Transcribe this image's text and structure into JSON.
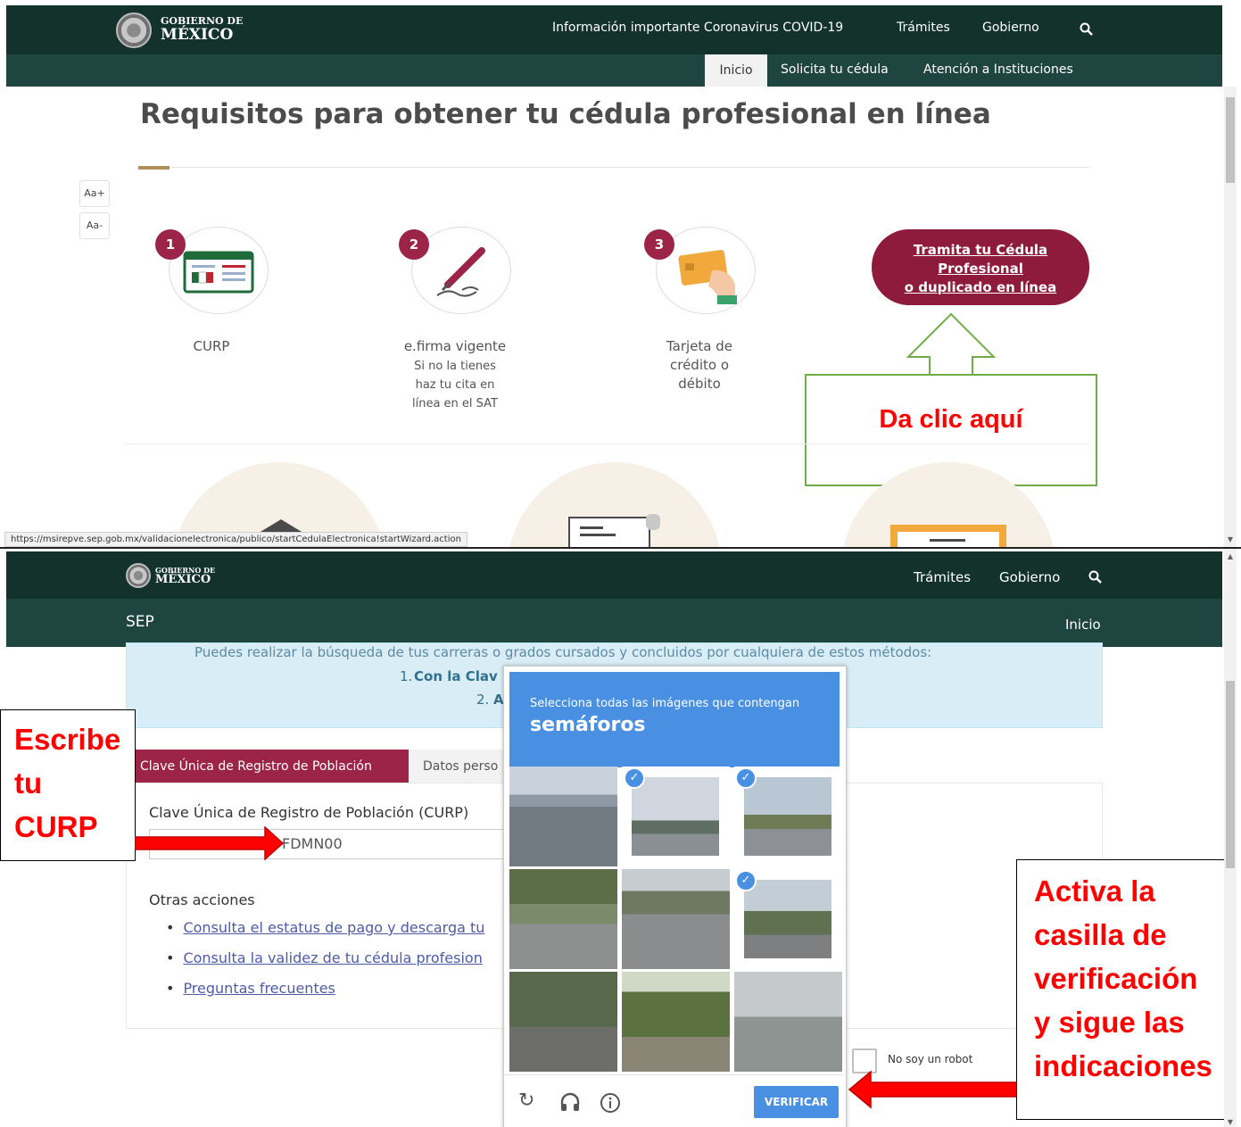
{
  "top": {
    "logo": {
      "line1": "GOBIERNO DE",
      "line2": "MÉXICO"
    },
    "nav_main": [
      "Información importante Coronavirus COVID-19",
      "Trámites",
      "Gobierno"
    ],
    "nav_sub": {
      "active": "Inicio",
      "items": [
        "Solicita tu cédula",
        "Atención a Instituciones"
      ]
    },
    "title": "Requisitos para obtener tu cédula profesional en línea",
    "font_buttons": [
      "Aa+",
      "Aa-"
    ],
    "steps": [
      {
        "num": "1",
        "label": "CURP",
        "lines": []
      },
      {
        "num": "2",
        "label": "e.firma vigente",
        "lines": [
          "Si no la tienes",
          "haz tu cita en",
          "línea en el SAT"
        ]
      },
      {
        "num": "3",
        "label": "Tarjeta de",
        "lines": [
          "crédito o",
          "débito"
        ]
      }
    ],
    "cta": [
      "Tramita tu Cédula",
      "Profesional",
      "o duplicado en línea"
    ],
    "callout": "Da clic aquí",
    "status_url": "https://msirepve.sep.gob.mx/validacionelectronica/publico/startCedulaElectronica!startWizard.action"
  },
  "bottom": {
    "logo": {
      "line1": "GOBIERNO DE",
      "line2": "MÉXICO"
    },
    "nav_main": [
      "Trámites",
      "Gobierno"
    ],
    "sep": "SEP",
    "inicio": "Inicio",
    "info": {
      "line1": "Puedes realizar la búsqueda de tus carreras o grados cursados y concluidos por cualquiera de estos métodos:",
      "item1_num": "1.",
      "item1": "Con la Clav",
      "item2_num": "2.",
      "item2": "A"
    },
    "tabs": [
      "Clave Única de Registro de Población",
      "Datos perso"
    ],
    "field_label": "Clave Única de Registro de Población (CURP)",
    "field_value": "FDMN00",
    "otras": "Otras acciones",
    "links": [
      "Consulta el estatus de pago y descarga tu",
      "Consulta la validez de tu cédula profesion",
      "Preguntas frecuentes"
    ],
    "label_curp": [
      "Escribe",
      "tu",
      "CURP"
    ],
    "label_verify": [
      "Activa la",
      "casilla de",
      "verificación",
      "y sigue las",
      "indicaciones"
    ],
    "captcha": {
      "instruction": "Selecciona todas las imágenes que contengan",
      "keyword": "semáforos",
      "verify": "VERIFICAR",
      "selected": [
        1,
        2,
        5
      ],
      "robot": "No soy un robot"
    }
  },
  "colors": {
    "nav_dark": "#13322b",
    "nav_sub": "#1f4540",
    "brand": "#9d2449",
    "captcha_blue": "#4a90e2",
    "callout_red": "#ff0000",
    "callout_green": "#70ad47"
  }
}
